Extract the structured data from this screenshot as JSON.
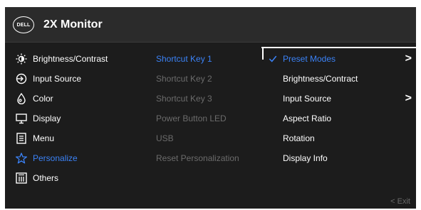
{
  "header": {
    "logo_text": "DELL",
    "title": "2X Monitor"
  },
  "main_menu": [
    {
      "label": "Brightness/Contrast",
      "icon": "brightness-icon",
      "state": "normal"
    },
    {
      "label": "Input Source",
      "icon": "input-source-icon",
      "state": "normal"
    },
    {
      "label": "Color",
      "icon": "color-icon",
      "state": "normal"
    },
    {
      "label": "Display",
      "icon": "display-icon",
      "state": "normal"
    },
    {
      "label": "Menu",
      "icon": "menu-icon",
      "state": "normal"
    },
    {
      "label": "Personalize",
      "icon": "star-icon",
      "state": "selected"
    },
    {
      "label": "Others",
      "icon": "others-icon",
      "state": "normal"
    }
  ],
  "submenu": [
    {
      "label": "Shortcut Key 1",
      "state": "selected"
    },
    {
      "label": "Shortcut Key 2",
      "state": "disabled"
    },
    {
      "label": "Shortcut Key 3",
      "state": "disabled"
    },
    {
      "label": "Power Button LED",
      "state": "disabled"
    },
    {
      "label": "USB",
      "state": "disabled"
    },
    {
      "label": "Reset Personalization",
      "state": "disabled"
    }
  ],
  "options": [
    {
      "label": "Preset Modes",
      "checked": true,
      "has_arrow": true
    },
    {
      "label": "Brightness/Contract",
      "checked": false,
      "has_arrow": false
    },
    {
      "label": "Input Source",
      "checked": false,
      "has_arrow": true
    },
    {
      "label": "Aspect Ratio",
      "checked": false,
      "has_arrow": false
    },
    {
      "label": "Rotation",
      "checked": false,
      "has_arrow": false
    },
    {
      "label": "Display Info",
      "checked": false,
      "has_arrow": false
    }
  ],
  "arrow_glyph": ">",
  "footer": {
    "exit_label": "< Exit"
  },
  "colors": {
    "accent": "#3b82f6",
    "background": "#1c1c1c",
    "header": "#2b2b2b",
    "disabled": "#6b6b6b"
  }
}
